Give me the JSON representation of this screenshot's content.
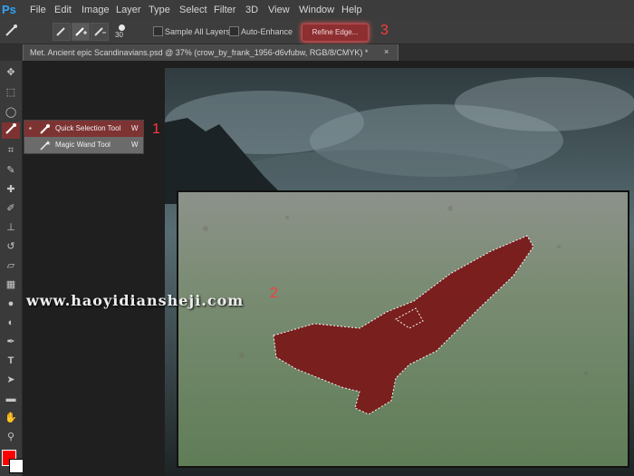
{
  "app": {
    "logo_text": "Ps"
  },
  "menubar": {
    "items": [
      "File",
      "Edit",
      "Image",
      "Layer",
      "Type",
      "Select",
      "Filter",
      "3D",
      "View",
      "Window",
      "Help"
    ]
  },
  "options_bar": {
    "brush_size": "30",
    "sample_all_layers": "Sample All Layers",
    "auto_enhance": "Auto-Enhance",
    "refine_edge": "Refine Edge..."
  },
  "document_tab": {
    "title": "Met. Ancient epic Scandinavians.psd @ 37% (crow_by_frank_1956-d6vfubw, RGB/8/CMYK) *",
    "close": "×"
  },
  "tool_flyout": {
    "items": [
      {
        "label": "Quick Selection Tool",
        "shortcut": "W",
        "active": true
      },
      {
        "label": "Magic Wand Tool",
        "shortcut": "W",
        "active": false
      }
    ]
  },
  "annotations": {
    "step1": "1",
    "step2": "2",
    "step3": "3"
  },
  "watermark": "www.haoyidiansheji.com",
  "colors": {
    "accent": "#d93535",
    "foreground": "#ff0000",
    "background": "#ffffff"
  },
  "icons": [
    "move-icon",
    "marquee-icon",
    "lasso-icon",
    "quick-selection-icon",
    "crop-icon",
    "eyedropper-icon",
    "healing-brush-icon",
    "brush-icon",
    "clone-stamp-icon",
    "history-brush-icon",
    "eraser-icon",
    "gradient-icon",
    "blur-icon",
    "dodge-icon",
    "pen-icon",
    "type-icon",
    "path-selection-icon",
    "shape-icon",
    "hand-icon",
    "zoom-icon"
  ]
}
